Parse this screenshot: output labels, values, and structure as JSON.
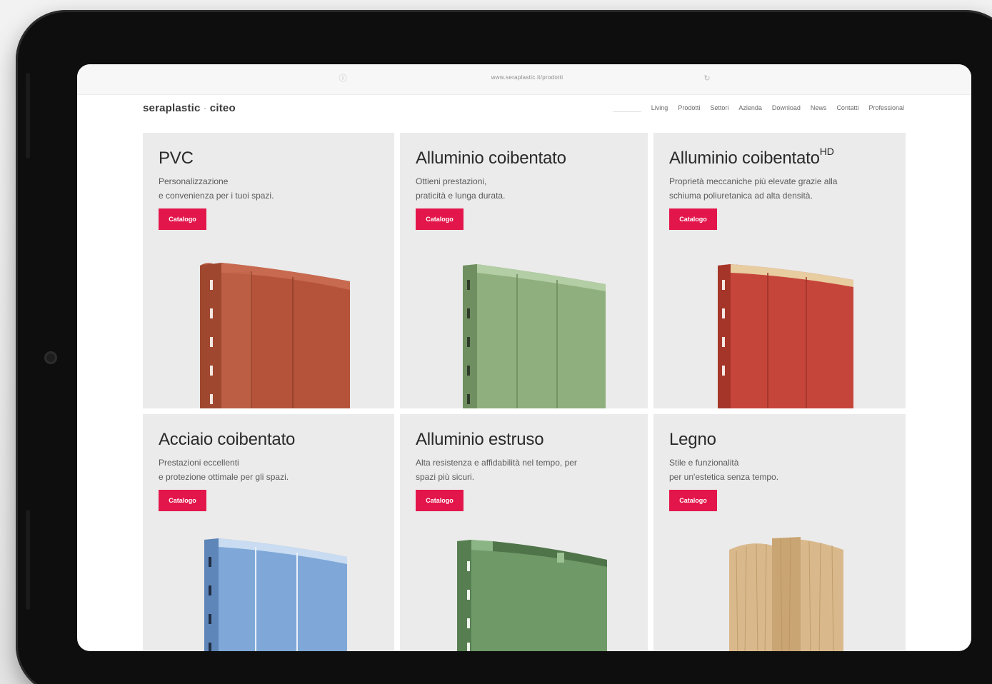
{
  "browser": {
    "url": "www.seraplastic.it/prodotti"
  },
  "site": {
    "logo_left": "seraplastic",
    "logo_sep": "·",
    "logo_right": "citeo"
  },
  "nav": {
    "items": [
      "Living",
      "Prodotti",
      "Settori",
      "Azienda",
      "Download",
      "News",
      "Contatti",
      "Professional"
    ]
  },
  "products": [
    {
      "title": "PVC",
      "sup": "",
      "desc_line1": "Personalizzazione",
      "desc_line2": "e convenienza per i tuoi spazi.",
      "button": "Catalogo",
      "color": "#b5533a"
    },
    {
      "title": "Alluminio coibentato",
      "sup": "",
      "desc_line1": "Ottieni prestazioni,",
      "desc_line2": "praticità e lunga durata.",
      "button": "Catalogo",
      "color": "#8fb07e"
    },
    {
      "title": "Alluminio coibentato",
      "sup": "HD",
      "desc_line1": "Proprietà meccaniche più elevate grazie alla",
      "desc_line2": "schiuma poliuretanica ad alta densità.",
      "button": "Catalogo",
      "color": "#c6453a"
    },
    {
      "title": "Acciaio coibentato",
      "sup": "",
      "desc_line1": "Prestazioni eccellenti",
      "desc_line2": "e protezione ottimale per gli spazi.",
      "button": "Catalogo",
      "color": "#7fa8d8"
    },
    {
      "title": "Alluminio estruso",
      "sup": "",
      "desc_line1": "Alta resistenza e affidabilità nel tempo, per",
      "desc_line2": "spazi più sicuri.",
      "button": "Catalogo",
      "color": "#6f9a68"
    },
    {
      "title": "Legno",
      "sup": "",
      "desc_line1": "Stile e funzionalità",
      "desc_line2": "per un'estetica senza tempo.",
      "button": "Catalogo",
      "color": "#d9b98c"
    }
  ],
  "icons": {
    "address_left": "info-icon",
    "address_right": "reload-icon",
    "nav_search": "search-box"
  }
}
